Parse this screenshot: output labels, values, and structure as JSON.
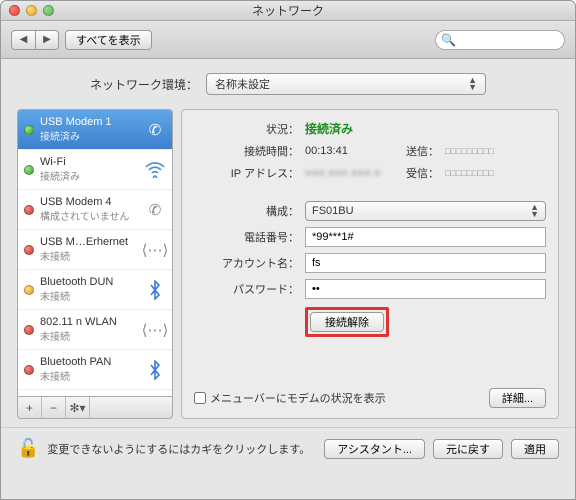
{
  "window": {
    "title": "ネットワーク"
  },
  "toolbar": {
    "show_all": "すべてを表示",
    "search_placeholder": ""
  },
  "location": {
    "label": "ネットワーク環境：",
    "selected": "名称未設定"
  },
  "sidebar": {
    "items": [
      {
        "name": "USB Modem 1",
        "status": "接続済み",
        "dot": "green",
        "icon": "phone-icon"
      },
      {
        "name": "Wi-Fi",
        "status": "接続済み",
        "dot": "green",
        "icon": "wifi-icon"
      },
      {
        "name": "USB Modem 4",
        "status": "構成されていません",
        "dot": "red",
        "icon": "phone-icon"
      },
      {
        "name": "USB M…Erhernet",
        "status": "未接続",
        "dot": "red",
        "icon": "ethernet-icon"
      },
      {
        "name": "Bluetooth DUN",
        "status": "未接続",
        "dot": "yellow",
        "icon": "bluetooth-icon"
      },
      {
        "name": "802.11 n WLAN",
        "status": "未接続",
        "dot": "red",
        "icon": "ethernet-icon"
      },
      {
        "name": "Bluetooth PAN",
        "status": "未接続",
        "dot": "red",
        "icon": "bluetooth-icon"
      }
    ],
    "buttons": {
      "add": "+",
      "remove": "−",
      "gear": "✻▾"
    }
  },
  "detail": {
    "labels": {
      "status": "状況：",
      "conn_time": "接続時間：",
      "ip": "IP アドレス：",
      "sent": "送信：",
      "recv": "受信：",
      "config": "構成：",
      "phone": "電話番号：",
      "account": "アカウント名：",
      "password": "パスワード："
    },
    "status_value": "接続済み",
    "conn_time_value": "00:13:41",
    "ip_value": "●●●.●●●.●●●.●",
    "sent_value": "□□□□□□□□□",
    "recv_value": "□□□□□□□□□",
    "config_value": "FS01BU",
    "phone_value": "*99***1#",
    "account_value": "fs",
    "password_value": "••",
    "disconnect": "接続解除",
    "show_modem_checkbox": "メニューバーにモデムの状況を表示",
    "advanced": "詳細..."
  },
  "footer": {
    "lock_message": "変更できないようにするにはカギをクリックします。",
    "assistant": "アシスタント...",
    "revert": "元に戻す",
    "apply": "適用"
  }
}
